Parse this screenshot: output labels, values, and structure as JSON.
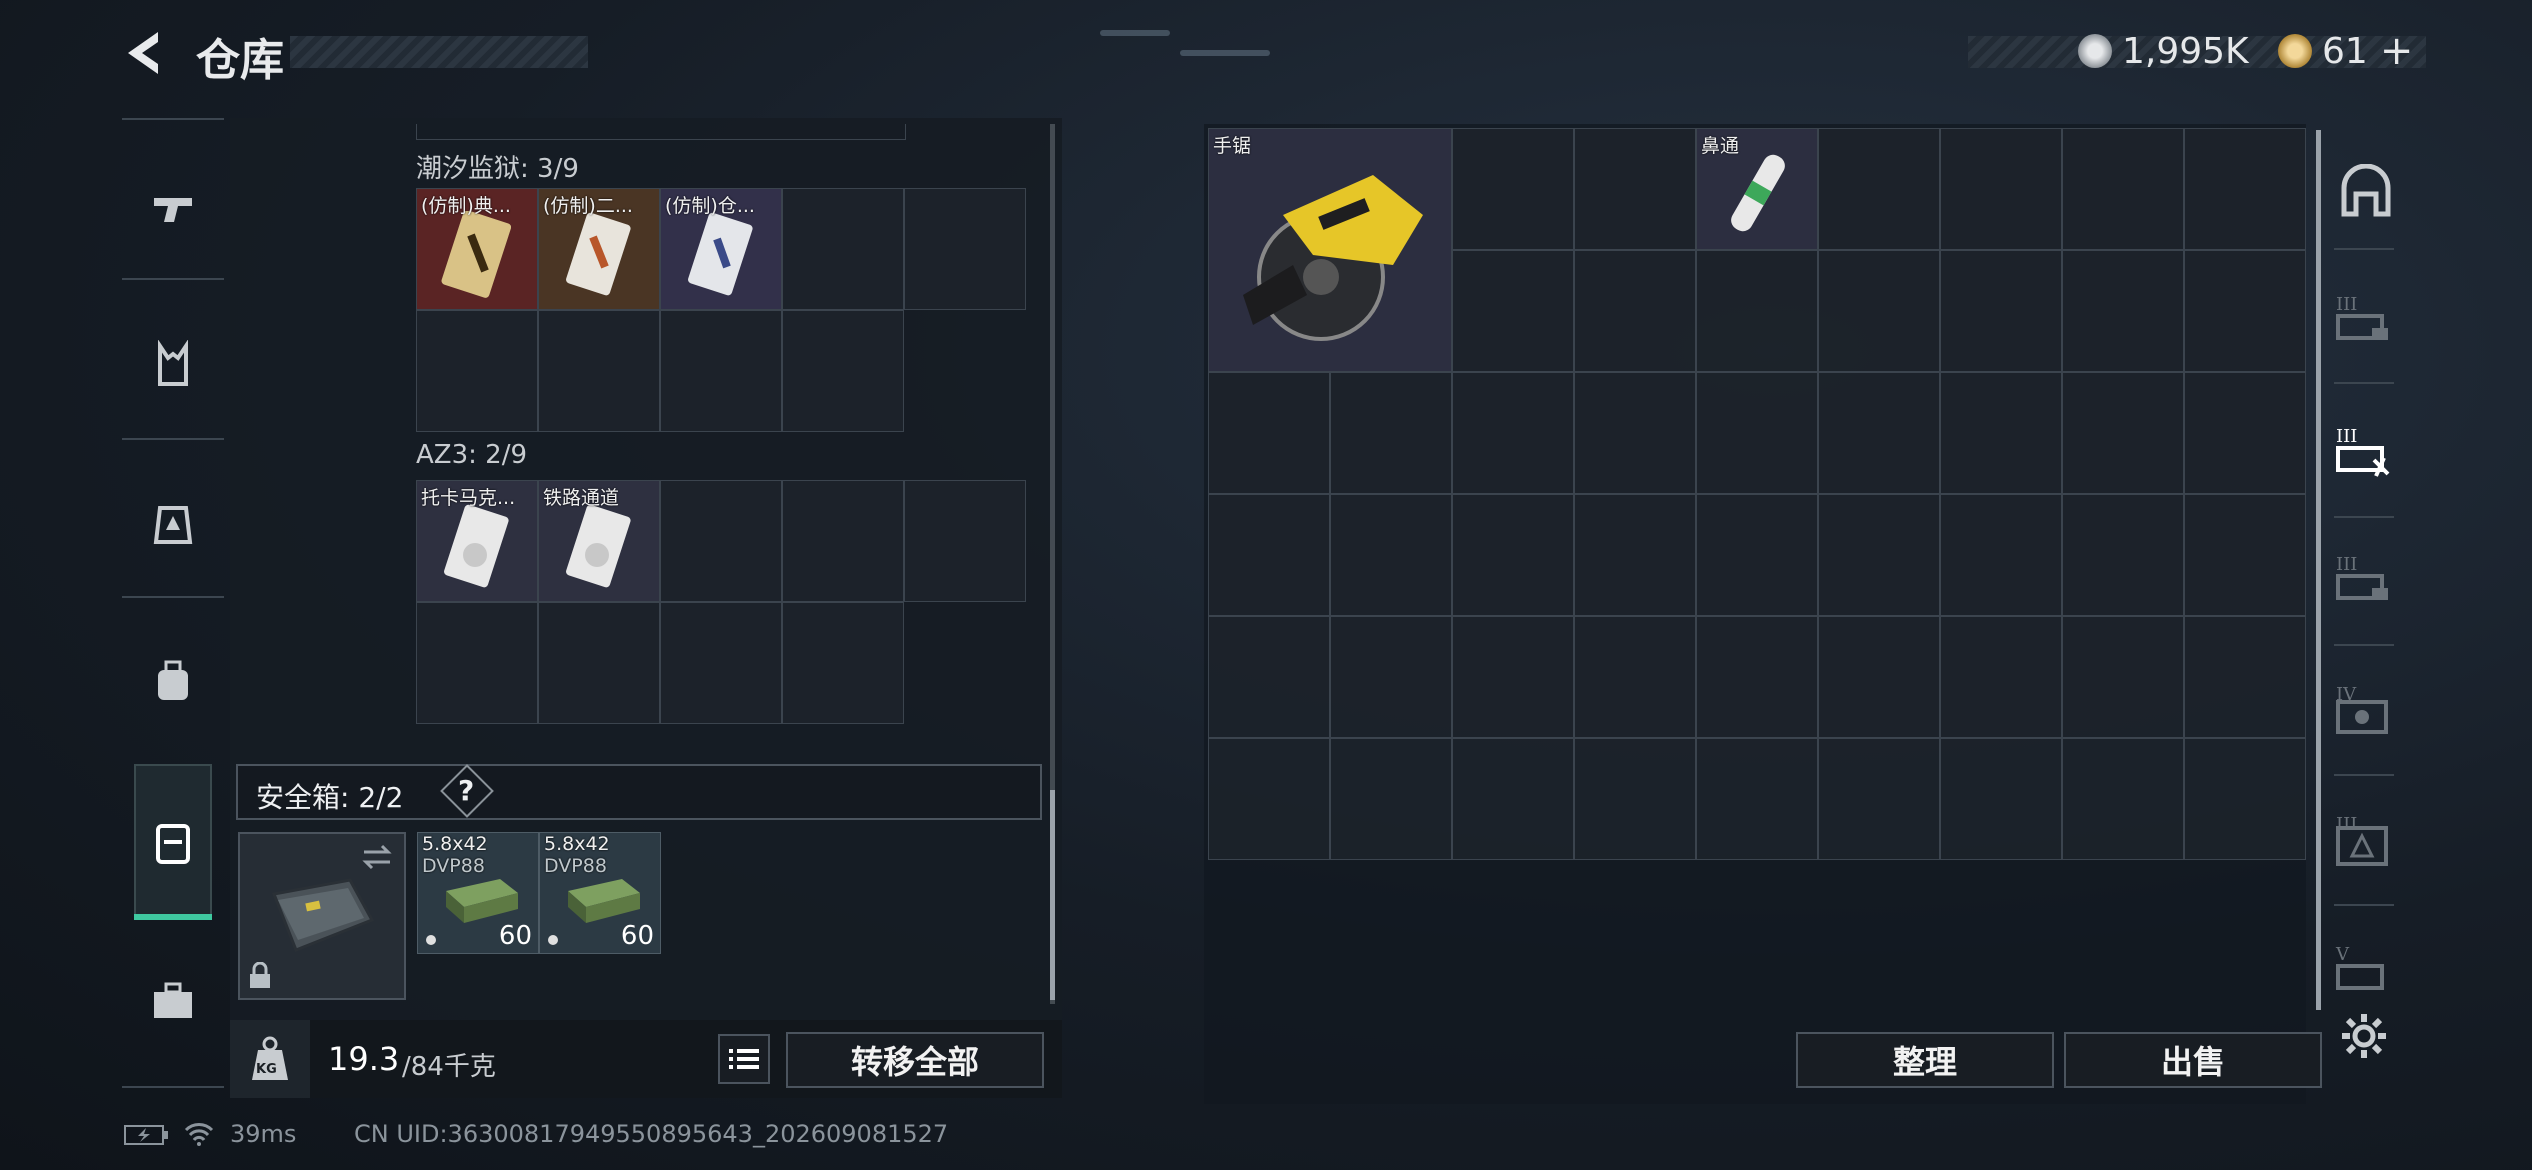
{
  "header": {
    "title": "仓库",
    "currency1": "1,995K",
    "currency2": "61",
    "plus": "+"
  },
  "left": {
    "section1_label": "潮汐监狱: 3/9",
    "section1_items": [
      "(仿制)典...",
      "(仿制)二...",
      "(仿制)仓..."
    ],
    "section2_label": "AZ3: 2/9",
    "section2_items": [
      "托卡马克...",
      "铁路通道"
    ],
    "safe_label": "安全箱: 2/2",
    "safe_help": "?",
    "ammo": [
      {
        "name1": "5.8x42",
        "name2": "DVP88",
        "count": "60"
      },
      {
        "name1": "5.8x42",
        "name2": "DVP88",
        "count": "60"
      }
    ],
    "weight_icon": "KG",
    "weight_current": "19.3",
    "weight_max": "/84千克",
    "transfer_all": "转移全部"
  },
  "right": {
    "items": [
      {
        "name": "手锯"
      },
      {
        "name": "鼻通"
      }
    ],
    "sort_button": "整理",
    "sell_button": "出售",
    "tier_labels": [
      "III",
      "III",
      "III",
      "IV",
      "III",
      "V"
    ]
  },
  "status": {
    "ping": "39ms",
    "uid": "CN UID:36300817949550895643_202609081527"
  },
  "icons": {
    "back": "back-arrow-icon",
    "settings": "gear-icon"
  },
  "colors": {
    "accent": "#3fc9a0",
    "item_red": "#5a2424",
    "item_orange": "#4a3524",
    "item_purple": "#32304a"
  }
}
